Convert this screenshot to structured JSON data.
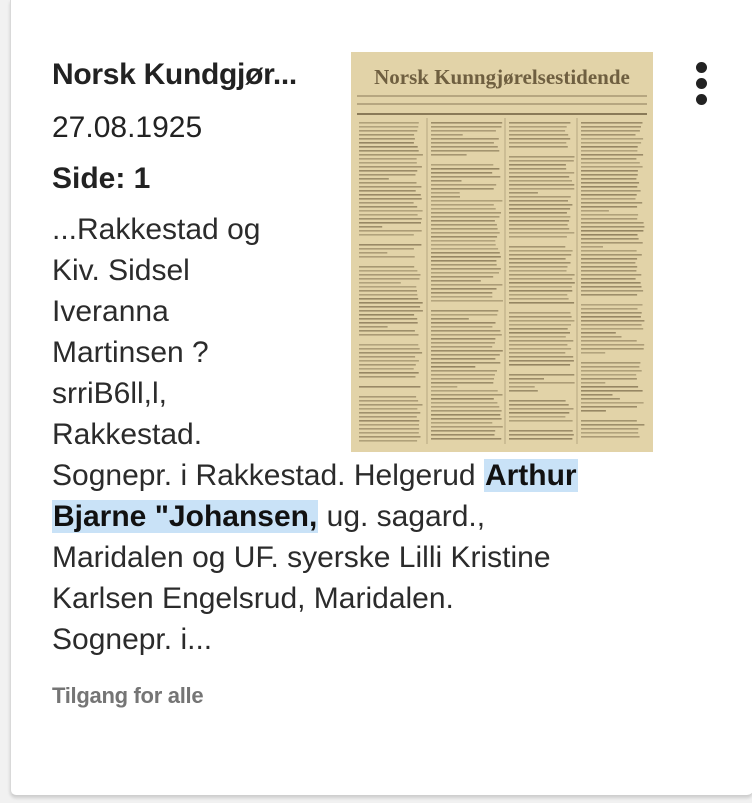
{
  "card": {
    "title": "Norsk Kundgjør...",
    "date": "27.08.1925",
    "page_label": "Side: 1",
    "snippet": {
      "line1": "...Rakkestad og",
      "line2": "Kiv. Sidsel",
      "line3": "Iveranna",
      "line4": "Martinsen ?",
      "line5": "srriB6ll,l,",
      "line6": "Rakkestad.",
      "line7_before": "Sognepr. i Rakkestad. Helgerud ",
      "line7_highlight": "Arthur",
      "line8_highlight": "Bjarne \"Johansen,",
      "line8_after": " ug. sagard.,",
      "line9": "Maridalen og UF. syerske Lilli Kristine",
      "line10": "Karlsen Engelsrud, Maridalen.",
      "line11": "Sognepr. i..."
    },
    "access": "Tilgang for alle",
    "thumbnail": {
      "masthead": "Norsk Kunngjørelsestidende",
      "paper_color": "#e2d3a8",
      "ink_color": "#7a6a4a"
    },
    "menu_icon": "more-vertical-icon",
    "highlight_color": "#c9e2f7"
  }
}
